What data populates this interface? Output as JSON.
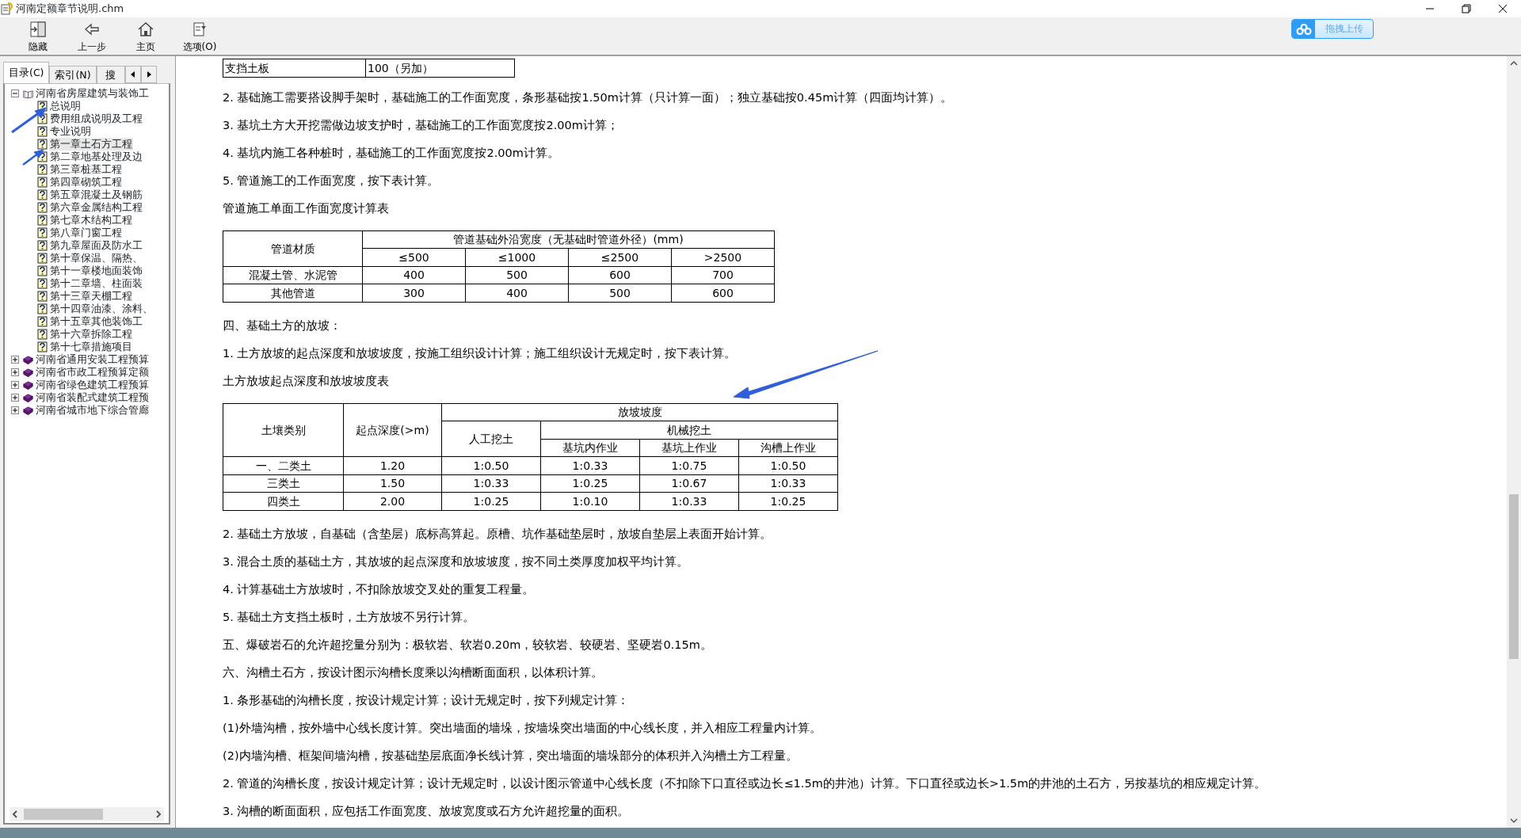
{
  "window": {
    "title": "河南定额章节说明.chm"
  },
  "toolbar": [
    {
      "kind": "hide",
      "label": "隐藏"
    },
    {
      "kind": "back",
      "label": "上一步"
    },
    {
      "kind": "home",
      "label": "主页"
    },
    {
      "kind": "options",
      "label": "选项(O)"
    }
  ],
  "upload_button": {
    "label": "拖拽上传"
  },
  "sidebar": {
    "tabs": [
      {
        "label": "目录(C)",
        "selected": true
      },
      {
        "label": "索引(N)",
        "selected": false
      },
      {
        "label": "搜",
        "selected": false
      }
    ],
    "tree": [
      {
        "label": "河南省房屋建筑与装饰工",
        "expanded": true,
        "children": [
          {
            "label": "总说明",
            "selected": false
          },
          {
            "label": "费用组成说明及工程",
            "selected": false
          },
          {
            "label": "专业说明",
            "selected": false
          },
          {
            "label": "第一章土石方工程",
            "selected": true
          },
          {
            "label": "第二章地基处理及边",
            "selected": false
          },
          {
            "label": "第三章桩基工程",
            "selected": false
          },
          {
            "label": "第四章砌筑工程",
            "selected": false
          },
          {
            "label": "第五章混凝土及钢筋",
            "selected": false
          },
          {
            "label": "第六章金属结构工程",
            "selected": false
          },
          {
            "label": "第七章木结构工程",
            "selected": false
          },
          {
            "label": "第八章门窗工程",
            "selected": false
          },
          {
            "label": "第九章屋面及防水工",
            "selected": false
          },
          {
            "label": "第十章保温、隔热、",
            "selected": false
          },
          {
            "label": "第十一章楼地面装饰",
            "selected": false
          },
          {
            "label": "第十二章墙、柱面装",
            "selected": false
          },
          {
            "label": "第十三章天棚工程",
            "selected": false
          },
          {
            "label": "第十四章油漆、涂料、",
            "selected": false
          },
          {
            "label": "第十五章其他装饰工",
            "selected": false
          },
          {
            "label": "第十六章拆除工程",
            "selected": false
          },
          {
            "label": "第十七章措施项目",
            "selected": false
          }
        ]
      },
      {
        "label": "河南省通用安装工程预算",
        "expanded": false
      },
      {
        "label": "河南省市政工程预算定额",
        "expanded": false
      },
      {
        "label": "河南省绿色建筑工程预算",
        "expanded": false
      },
      {
        "label": "河南省装配式建筑工程预",
        "expanded": false
      },
      {
        "label": "河南省城市地下综合管廊",
        "expanded": false
      }
    ]
  },
  "content": [
    {
      "kind": "table",
      "rows": [
        [
          {
            "text": "支挡土板"
          },
          {
            "text": "100（另加）"
          }
        ]
      ]
    },
    {
      "kind": "paragraph",
      "text": "2. 基础施工需要搭设脚手架时，基础施工的工作面宽度，条形基础按1.50m计算（只计算一面）；独立基础按0.45m计算（四面均计算）。"
    },
    {
      "kind": "paragraph",
      "text": "3. 基坑土方大开挖需做边坡支护时，基础施工的工作面宽度按2.00m计算；"
    },
    {
      "kind": "paragraph",
      "text": "4. 基坑内施工各种桩时，基础施工的工作面宽度按2.00m计算。"
    },
    {
      "kind": "paragraph",
      "text": "5. 管道施工的工作面宽度，按下表计算。"
    },
    {
      "kind": "paragraph",
      "text": "管道施工单面工作面宽度计算表"
    },
    {
      "kind": "table",
      "header": {
        "labels": [
          "管道材质"
        ],
        "group": "管道基础外沿宽度（无基础时管道外径）(mm)",
        "columns": [
          {
            "label": "≤500"
          },
          {
            "label": "≤1000"
          },
          {
            "label": "≤2500"
          },
          {
            "label": ">2500"
          }
        ]
      },
      "rows": [
        [
          {
            "text": "混凝土管、水泥管"
          },
          {
            "text": "400"
          },
          {
            "text": "500"
          },
          {
            "text": "600"
          },
          {
            "text": "700"
          }
        ],
        [
          {
            "text": "其他管道"
          },
          {
            "text": "300"
          },
          {
            "text": "400"
          },
          {
            "text": "500"
          },
          {
            "text": "600"
          }
        ]
      ]
    },
    {
      "kind": "paragraph",
      "text": "四、基础土方的放坡："
    },
    {
      "kind": "paragraph",
      "text": "1. 土方放坡的起点深度和放坡坡度，按施工组织设计计算；施工组织设计无规定时，按下表计算。"
    },
    {
      "kind": "paragraph",
      "text": "土方放坡起点深度和放坡坡度表"
    },
    {
      "kind": "table",
      "header": {
        "labels": [
          "土壤类别",
          "起点深度(>m)"
        ],
        "group": "放坡坡度",
        "columns": [
          {
            "label": "人工挖土"
          },
          {
            "label": "机械挖土",
            "columns": [
              {
                "label": "基坑内作业"
              },
              {
                "label": "基坑上作业"
              },
              {
                "label": "沟槽上作业"
              }
            ]
          }
        ]
      },
      "rows": [
        [
          {
            "text": "一、二类土"
          },
          {
            "text": "1.20"
          },
          {
            "text": "1:0.50"
          },
          {
            "text": "1:0.33"
          },
          {
            "text": "1:0.75"
          },
          {
            "text": "1:0.50"
          }
        ],
        [
          {
            "text": "三类土"
          },
          {
            "text": "1.50"
          },
          {
            "text": "1:0.33"
          },
          {
            "text": "1:0.25"
          },
          {
            "text": "1:0.67"
          },
          {
            "text": "1:0.33"
          }
        ],
        [
          {
            "text": "四类土"
          },
          {
            "text": "2.00"
          },
          {
            "text": "1:0.25"
          },
          {
            "text": "1:0.10"
          },
          {
            "text": "1:0.33"
          },
          {
            "text": "1:0.25"
          }
        ]
      ]
    },
    {
      "kind": "paragraph",
      "text": "2. 基础土方放坡，自基础（含垫层）底标高算起。原槽、坑作基础垫层时，放坡自垫层上表面开始计算。"
    },
    {
      "kind": "paragraph",
      "text": "3. 混合土质的基础土方，其放坡的起点深度和放坡坡度，按不同土类厚度加权平均计算。"
    },
    {
      "kind": "paragraph",
      "text": "4. 计算基础土方放坡时，不扣除放坡交叉处的重复工程量。"
    },
    {
      "kind": "paragraph",
      "text": "5. 基础土方支挡土板时，土方放坡不另行计算。"
    },
    {
      "kind": "paragraph",
      "text": "五、爆破岩石的允许超挖量分别为：极软岩、软岩0.20m，较软岩、较硬岩、坚硬岩0.15m。"
    },
    {
      "kind": "paragraph",
      "text": "六、沟槽土石方，按设计图示沟槽长度乘以沟槽断面面积，以体积计算。"
    },
    {
      "kind": "paragraph",
      "text": "1. 条形基础的沟槽长度，按设计规定计算；设计无规定时，按下列规定计算："
    },
    {
      "kind": "paragraph",
      "text": "(1)外墙沟槽，按外墙中心线长度计算。突出墙面的墙垛，按墙垛突出墙面的中心线长度，并入相应工程量内计算。"
    },
    {
      "kind": "paragraph",
      "text": "(2)内墙沟槽、框架间墙沟槽，按基础垫层底面净长线计算，突出墙面的墙垛部分的体积并入沟槽土方工程量。"
    },
    {
      "kind": "paragraph",
      "text": "2. 管道的沟槽长度，按设计规定计算；设计无规定时，以设计图示管道中心线长度（不扣除下口直径或边长≤1.5m的井池）计算。下口直径或边长>1.5m的井池的土石方，另按基坑的相应规定计算。"
    },
    {
      "kind": "paragraph",
      "text": "3. 沟槽的断面面积，应包括工作面宽度、放坡宽度或石方允许超挖量的面积。"
    }
  ]
}
